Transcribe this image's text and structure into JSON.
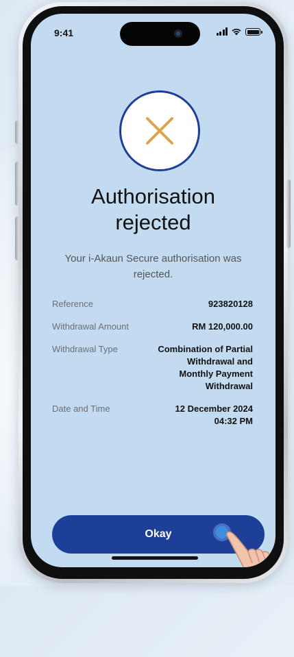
{
  "status_bar": {
    "time": "9:41"
  },
  "result": {
    "icon": "close-x-icon",
    "title": "Authorisation\nrejected",
    "message": "Your i-Akaun Secure authorisation was rejected."
  },
  "details": [
    {
      "label": "Reference",
      "value": "923820128"
    },
    {
      "label": "Withdrawal Amount",
      "value": "RM 120,000.00"
    },
    {
      "label": "Withdrawal Type",
      "value": "Combination of Partial\nWithdrawal  and\nMonthly Payment\nWithdrawal"
    },
    {
      "label": "Date and Time",
      "value": "12 December 2024\n04:32 PM"
    }
  ],
  "actions": {
    "okay_label": "Okay"
  },
  "colors": {
    "screen_bg": "#c3dbf1",
    "primary": "#1e3f98",
    "icon_accent": "#dba44a"
  }
}
